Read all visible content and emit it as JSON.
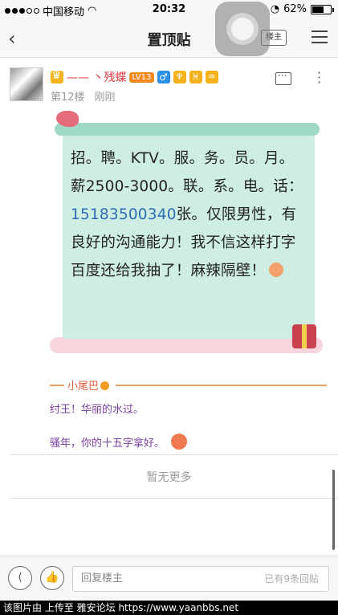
{
  "status_bar": {
    "carrier": "中国移动",
    "time": "20:32",
    "battery": "62%",
    "battery_level": 0.62
  },
  "nav": {
    "title": "置顶贴",
    "owner_button": "楼主"
  },
  "post": {
    "username": "—— 丶残蝶",
    "level": "LV13",
    "floor": "第12楼",
    "time": "刚刚",
    "content_prefix": "招。聘。KTV。服。务。员。月。薪2500-3000。联。系。电。话：",
    "phone": "15183500340",
    "content_suffix": "张。仅限男性，有良好的沟通能力！我不信这样打字百度还给我抽了！麻辣隔壁！"
  },
  "tail": {
    "label": "小尾巴",
    "line1": "纣王！华丽的水过。",
    "line2": "骚年，你的十五字拿好。"
  },
  "no_more": "暂无更多",
  "bottom": {
    "reply_placeholder": "回复楼主",
    "reply_count": "已有9条回贴"
  },
  "footer": "该图片由  上传至 雅安论坛 https://www.yaanbbs.net",
  "icons": [
    "wifi-icon",
    "back-icon",
    "menu-icon",
    "comment-icon",
    "more-icon",
    "share-icon",
    "like-icon"
  ]
}
